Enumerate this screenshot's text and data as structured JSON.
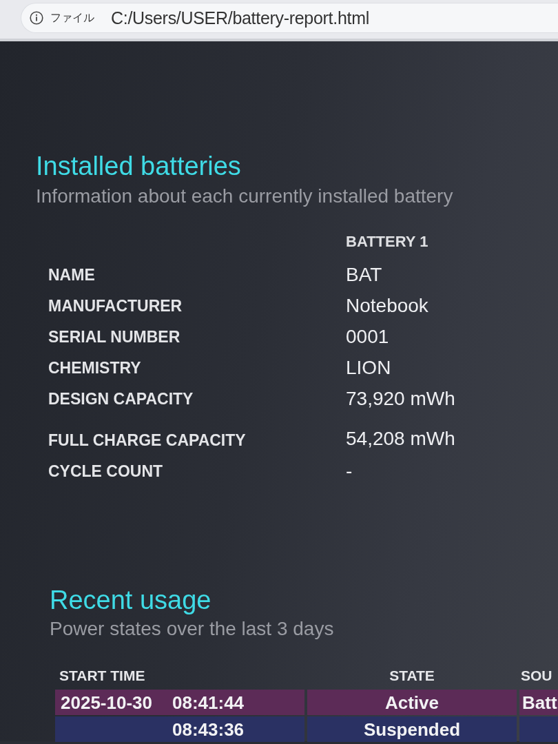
{
  "address_bar": {
    "scheme_label": "ファイル",
    "url": "C:/Users/USER/battery-report.html"
  },
  "installed_batteries": {
    "title": "Installed batteries",
    "subtitle": "Information about each currently installed battery",
    "column_heading": "BATTERY 1",
    "rows": [
      {
        "label": "NAME",
        "value": "BAT"
      },
      {
        "label": "MANUFACTURER",
        "value": "Notebook"
      },
      {
        "label": "SERIAL NUMBER",
        "value": "0001"
      },
      {
        "label": "CHEMISTRY",
        "value": "LION"
      },
      {
        "label": "DESIGN CAPACITY",
        "value": "73,920 mWh"
      },
      {
        "label": "FULL CHARGE CAPACITY",
        "value": "54,208 mWh"
      },
      {
        "label": "CYCLE COUNT",
        "value": "-"
      }
    ]
  },
  "recent_usage": {
    "title": "Recent usage",
    "subtitle": "Power states over the last 3 days",
    "columns": [
      "START TIME",
      "STATE",
      "SOU"
    ],
    "rows": [
      {
        "kind": "active",
        "date": "2025-10-30",
        "time": "08:41:44",
        "state": "Active",
        "source": "Batt"
      },
      {
        "kind": "suspended",
        "time": "08:43:36",
        "state": "Suspended"
      }
    ]
  }
}
